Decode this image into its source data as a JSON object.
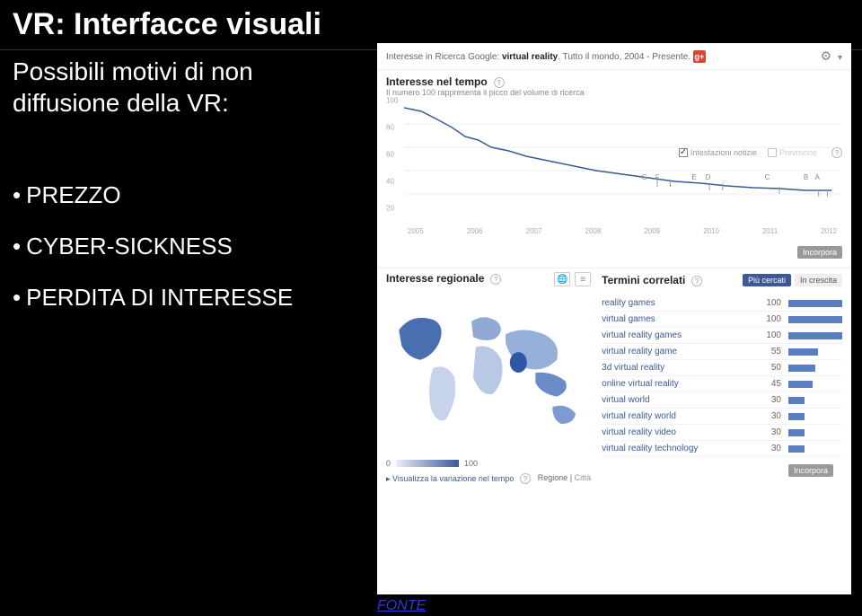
{
  "slide": {
    "title": "VR: Interfacce visuali",
    "subtitle": "Possibili motivi di non diffusione della VR:",
    "bullets": [
      "PREZZO",
      "CYBER-SICKNESS",
      "PERDITA DI INTERESSE"
    ],
    "fonte": "FONTE"
  },
  "trends": {
    "header_prefix": "Interesse in Ricerca Google: ",
    "header_term": "virtual reality",
    "header_scope": ". Tutto il mondo, 2004 - Presente.",
    "gplus": "g+",
    "interest_time_title": "Interesse nel tempo",
    "interest_time_sub": "Il numero 100 rappresenta il picco del volume di ricerca",
    "opt_headlines": "Intestazioni notizie",
    "opt_forecast": "Previsione",
    "incorpora": "Incorpora",
    "regional_title": "Interesse regionale",
    "related_title": "Termini correlati",
    "tab_top": "Più cercati",
    "tab_rising": "In crescita",
    "legend_min": "0",
    "legend_max": "100",
    "viz_label": "Visualizza la variazione nel tempo",
    "region_toggle_a": "Regione",
    "region_toggle_b": "Città"
  },
  "chart_data": {
    "type": "line",
    "title": "Interesse nel tempo",
    "xlabel": "",
    "ylabel": "",
    "ylim": [
      0,
      100
    ],
    "y_ticks": [
      20,
      40,
      60,
      80,
      100
    ],
    "categories": [
      "2005",
      "2006",
      "2007",
      "2008",
      "2009",
      "2010",
      "2011",
      "2012"
    ],
    "values": [
      95,
      80,
      62,
      50,
      44,
      40,
      36,
      33,
      30,
      28,
      27,
      26,
      26,
      25,
      24,
      24,
      23,
      23
    ],
    "markers": [
      "G",
      "F",
      "E",
      "D",
      "C",
      "B",
      "A"
    ]
  },
  "related": [
    {
      "label": "reality games",
      "value": 100
    },
    {
      "label": "virtual games",
      "value": 100
    },
    {
      "label": "virtual reality games",
      "value": 100
    },
    {
      "label": "virtual reality game",
      "value": 55
    },
    {
      "label": "3d virtual reality",
      "value": 50
    },
    {
      "label": "online virtual reality",
      "value": 45
    },
    {
      "label": "virtual world",
      "value": 30
    },
    {
      "label": "virtual reality world",
      "value": 30
    },
    {
      "label": "virtual reality video",
      "value": 30
    },
    {
      "label": "virtual reality technology",
      "value": 30
    }
  ]
}
